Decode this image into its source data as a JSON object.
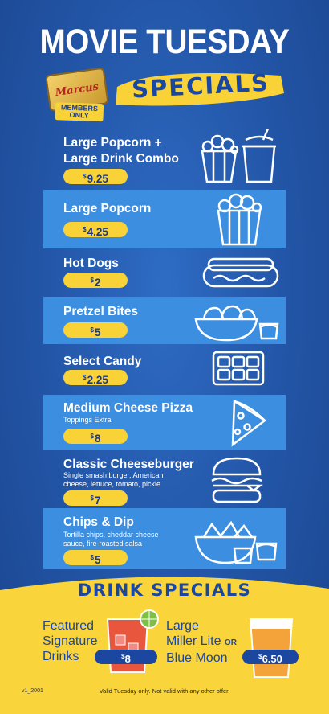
{
  "header": {
    "title": "MOVIE TUESDAY",
    "specials": "SPECIALS",
    "badge_logo": "Marcus",
    "badge_members": "MEMBERS",
    "badge_only": "ONLY"
  },
  "menu": {
    "items": [
      {
        "name_line1": "Large Popcorn +",
        "name_line2": "Large Drink Combo",
        "price": "9.25",
        "icon": "popcorn-drink-combo-icon"
      },
      {
        "name_line1": "Large Popcorn",
        "price": "4.25",
        "icon": "popcorn-bucket-icon"
      },
      {
        "name_line1": "Hot Dogs",
        "price": "2",
        "icon": "hot-dog-icon"
      },
      {
        "name_line1": "Pretzel Bites",
        "price": "5",
        "icon": "pretzel-bites-icon"
      },
      {
        "name_line1": "Select Candy",
        "price": "2.25",
        "icon": "candy-bar-icon"
      },
      {
        "name_line1": "Medium Cheese Pizza",
        "desc_line1": "Toppings Extra",
        "price": "8",
        "icon": "pizza-slice-icon"
      },
      {
        "name_line1": "Classic Cheeseburger",
        "desc_line1": "Single smash burger, American",
        "desc_line2": "cheese, lettuce, tomato, pickle",
        "price": "7",
        "icon": "cheeseburger-icon"
      },
      {
        "name_line1": "Chips & Dip",
        "desc_line1": "Tortilla chips, cheddar cheese",
        "desc_line2": "sauce, fire-roasted salsa",
        "price": "5",
        "icon": "chips-dip-icon"
      }
    ]
  },
  "drinks": {
    "title": "DRINK SPECIALS",
    "left_line1": "Featured",
    "left_line2": "Signature",
    "left_line3": "Drinks",
    "left_price": "8",
    "right_line1": "Large",
    "right_line2": "Miller Lite",
    "right_or": "OR",
    "right_line3": "Blue Moon",
    "right_price": "6.50"
  },
  "footer": {
    "code": "v1_2001",
    "note": "Valid Tuesday only. Not valid with any other offer."
  },
  "colors": {
    "background_blue": "#2456a6",
    "band_blue": "#3b8ee0",
    "price_yellow": "#f8d236",
    "text_navy": "#1c47a0"
  }
}
